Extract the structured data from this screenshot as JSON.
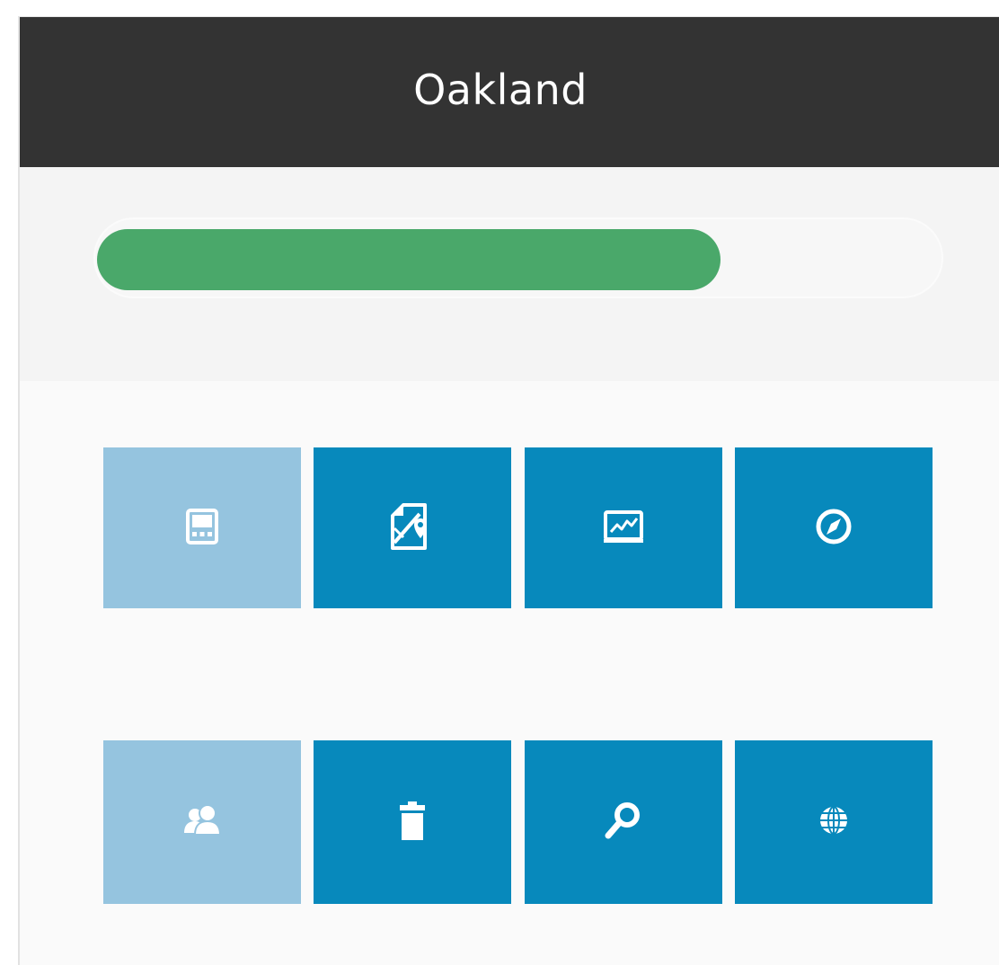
{
  "header": {
    "title": "Oakland"
  },
  "progress": {
    "fraction": 0.74,
    "fill_color": "#4aa86a"
  },
  "colors": {
    "tile_dark": "#0789bc",
    "tile_light": "#95c4df",
    "icon": "#ffffff"
  },
  "tiles": [
    {
      "icon": "calculator-icon",
      "style": "light"
    },
    {
      "icon": "map-location-icon",
      "style": "dark"
    },
    {
      "icon": "chart-monitor-icon",
      "style": "dark"
    },
    {
      "icon": "compass-icon",
      "style": "dark"
    },
    {
      "icon": "users-icon",
      "style": "light"
    },
    {
      "icon": "trash-icon",
      "style": "dark"
    },
    {
      "icon": "search-icon",
      "style": "dark"
    },
    {
      "icon": "globe-icon",
      "style": "dark"
    }
  ]
}
